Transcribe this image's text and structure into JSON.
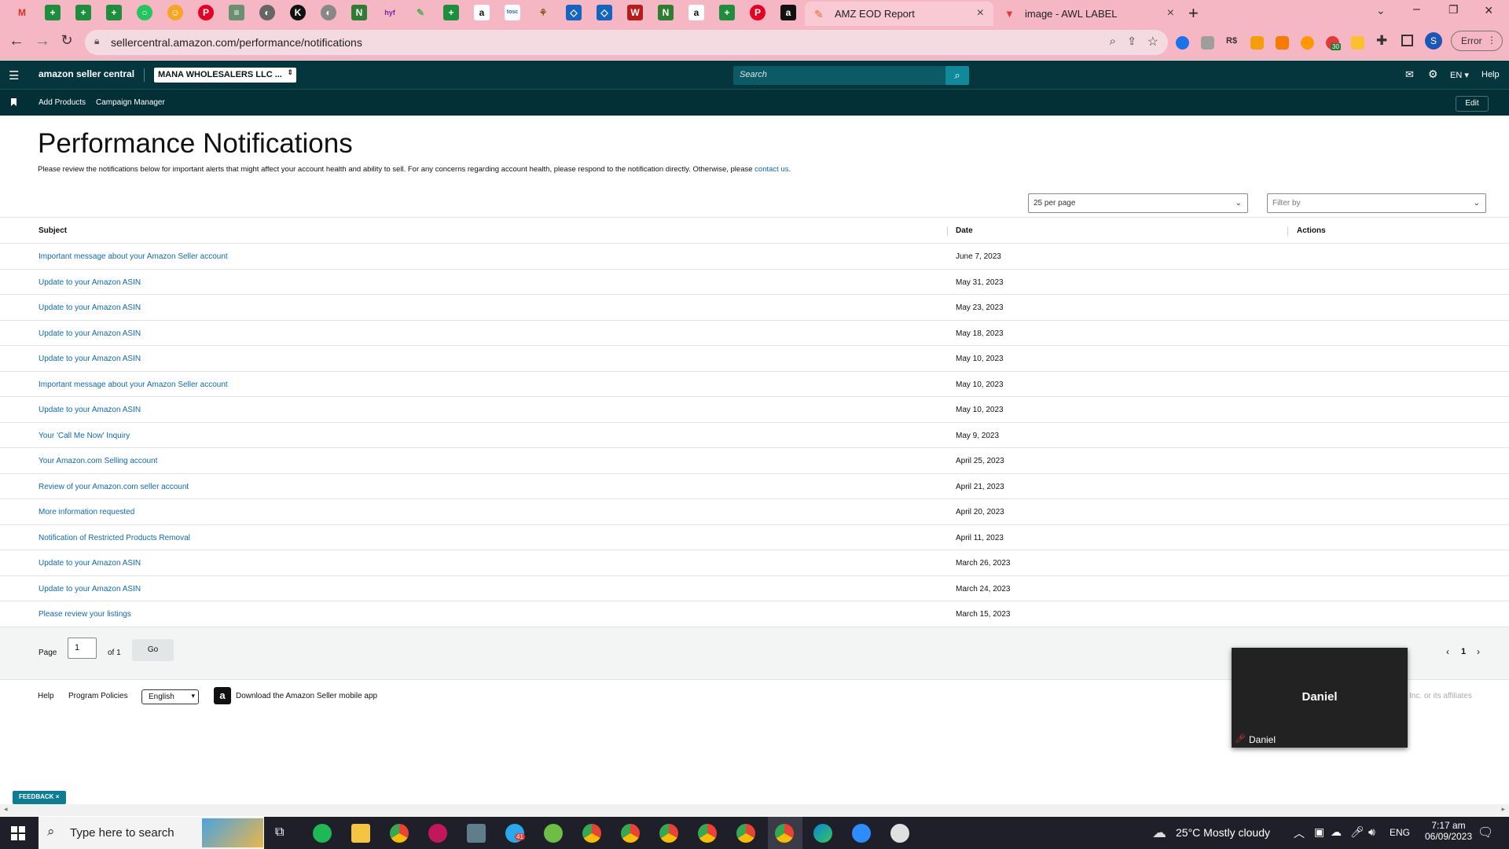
{
  "browser": {
    "tabs": [
      {
        "title": "AMZ EOD Report",
        "active": false
      },
      {
        "title": "image - AWL LABEL",
        "active": false
      }
    ],
    "new_tab": "+",
    "url": "sellercentral.amazon.com/performance/notifications",
    "profile_initial": "S",
    "error_label": "Error",
    "extension_badge": "30"
  },
  "seller": {
    "logo": "amazon seller central",
    "merchant": "MANA WHOLESALERS LLC ...",
    "search_placeholder": "Search",
    "language": "EN",
    "help": "Help",
    "bookmarks": [
      "Add Products",
      "Campaign Manager"
    ],
    "edit": "Edit"
  },
  "page": {
    "title": "Performance Notifications",
    "description": "Please review the notifications below for important alerts that might affect your account health and ability to sell. For any concerns regarding account health, please respond to the notification directly. Otherwise, please",
    "contact_link": "contact us",
    "description_end": ".",
    "per_page": "25 per page",
    "filter_placeholder": "Filter by"
  },
  "table": {
    "headers": {
      "subject": "Subject",
      "date": "Date",
      "actions": "Actions"
    },
    "rows": [
      {
        "subject": "Important message about your Amazon Seller account",
        "date": "June 7, 2023"
      },
      {
        "subject": "Update to your Amazon ASIN",
        "date": "May 31, 2023"
      },
      {
        "subject": "Update to your Amazon ASIN",
        "date": "May 23, 2023"
      },
      {
        "subject": "Update to your Amazon ASIN",
        "date": "May 18, 2023"
      },
      {
        "subject": "Update to your Amazon ASIN",
        "date": "May 10, 2023"
      },
      {
        "subject": "Important message about your Amazon Seller account",
        "date": "May 10, 2023"
      },
      {
        "subject": "Update to your Amazon ASIN",
        "date": "May 10, 2023"
      },
      {
        "subject": "Your 'Call Me Now' Inquiry",
        "date": "May 9, 2023"
      },
      {
        "subject": "Your Amazon.com Selling account",
        "date": "April 25, 2023"
      },
      {
        "subject": "Review of your Amazon.com seller account",
        "date": "April 21, 2023"
      },
      {
        "subject": "More information requested",
        "date": "April 20, 2023"
      },
      {
        "subject": "Notification of Restricted Products Removal",
        "date": "April 11, 2023"
      },
      {
        "subject": "Update to your Amazon ASIN",
        "date": "March 26, 2023"
      },
      {
        "subject": "Update to your Amazon ASIN",
        "date": "March 24, 2023"
      },
      {
        "subject": "Please review your listings",
        "date": "March 15, 2023"
      }
    ]
  },
  "pager": {
    "page_label": "Page",
    "page_value": "1",
    "of_label": "of 1",
    "go": "Go",
    "current": "1"
  },
  "footer": {
    "help": "Help",
    "policies": "Program Policies",
    "language": "English",
    "app": "Download the Amazon Seller mobile app",
    "copyright_fragment": "Inc. or its affiliates"
  },
  "video": {
    "name": "Daniel",
    "label": "Daniel"
  },
  "feedback": "FEEDBACK",
  "taskbar": {
    "search_placeholder": "Type here to search",
    "weather": "25°C  Mostly cloudy",
    "lang": "ENG",
    "time": "7:17 am",
    "date": "06/09/2023",
    "badge": "41"
  },
  "colors": {
    "tab_bar": "#f6b7c5",
    "seller_nav": "#05363e",
    "link": "#0d6ab4",
    "search_button": "#0f8a9b"
  }
}
